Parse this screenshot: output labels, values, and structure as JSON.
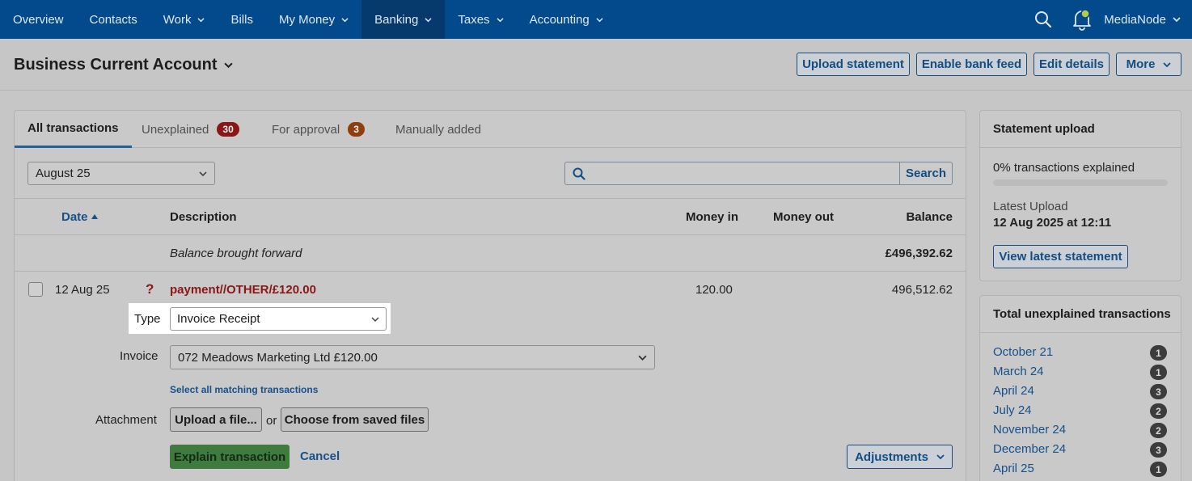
{
  "nav": {
    "items": [
      {
        "label": "Overview",
        "has_dropdown": false
      },
      {
        "label": "Contacts",
        "has_dropdown": false
      },
      {
        "label": "Work",
        "has_dropdown": true
      },
      {
        "label": "Bills",
        "has_dropdown": false
      },
      {
        "label": "My Money",
        "has_dropdown": true
      },
      {
        "label": "Banking",
        "has_dropdown": true,
        "active": true
      },
      {
        "label": "Taxes",
        "has_dropdown": true
      },
      {
        "label": "Accounting",
        "has_dropdown": true
      }
    ],
    "org_name": "MediaNode",
    "icons": [
      "search-icon",
      "bell-icon"
    ]
  },
  "header": {
    "account_title": "Business Current Account",
    "buttons": {
      "upload_statement": "Upload statement",
      "enable_bank_feed": "Enable bank feed",
      "edit_details": "Edit details",
      "more": "More"
    }
  },
  "tabs": {
    "all": "All transactions",
    "unexplained": "Unexplained",
    "unexplained_count": "30",
    "approval": "For approval",
    "approval_count": "3",
    "manual": "Manually added"
  },
  "filters": {
    "month": "August 25",
    "search_value": "",
    "search_button": "Search"
  },
  "table": {
    "headers": {
      "date": "Date",
      "description": "Description",
      "money_in": "Money in",
      "money_out": "Money out",
      "balance": "Balance"
    },
    "brought_forward": {
      "label": "Balance brought forward",
      "balance": "£496,392.62"
    },
    "transaction": {
      "date": "12 Aug 25",
      "status_glyph": "?",
      "description": "payment//OTHER/£120.00",
      "money_in": "120.00",
      "money_out": "",
      "balance": "496,512.62"
    }
  },
  "explain_form": {
    "type_label": "Type",
    "type_value": "Invoice Receipt",
    "invoice_label": "Invoice",
    "invoice_value": "072 Meadows Marketing Ltd £120.00",
    "select_matching": "Select all matching transactions",
    "attachment_label": "Attachment",
    "upload_file": "Upload a file...",
    "or": "or",
    "choose_saved": "Choose from saved files",
    "explain_button": "Explain transaction",
    "cancel": "Cancel",
    "adjustments": "Adjustments"
  },
  "statement_upload": {
    "title": "Statement upload",
    "explained_text": "0% transactions explained",
    "explained_progress": 0,
    "latest_label": "Latest Upload",
    "latest_value": "12 Aug 2025 at 12:11",
    "view_button": "View latest statement"
  },
  "unexplained_totals": {
    "title": "Total unexplained transactions",
    "items": [
      {
        "label": "October 21",
        "count": "1"
      },
      {
        "label": "March 24",
        "count": "1"
      },
      {
        "label": "April 24",
        "count": "3"
      },
      {
        "label": "July 24",
        "count": "2"
      },
      {
        "label": "November 24",
        "count": "2"
      },
      {
        "label": "December 24",
        "count": "3"
      },
      {
        "label": "April 25",
        "count": "1"
      }
    ]
  },
  "colors": {
    "nav_bg": "#034a8c",
    "nav_active": "#063a6c",
    "link": "#17508a",
    "danger": "#8a1616",
    "success": "#3f7a3f"
  }
}
